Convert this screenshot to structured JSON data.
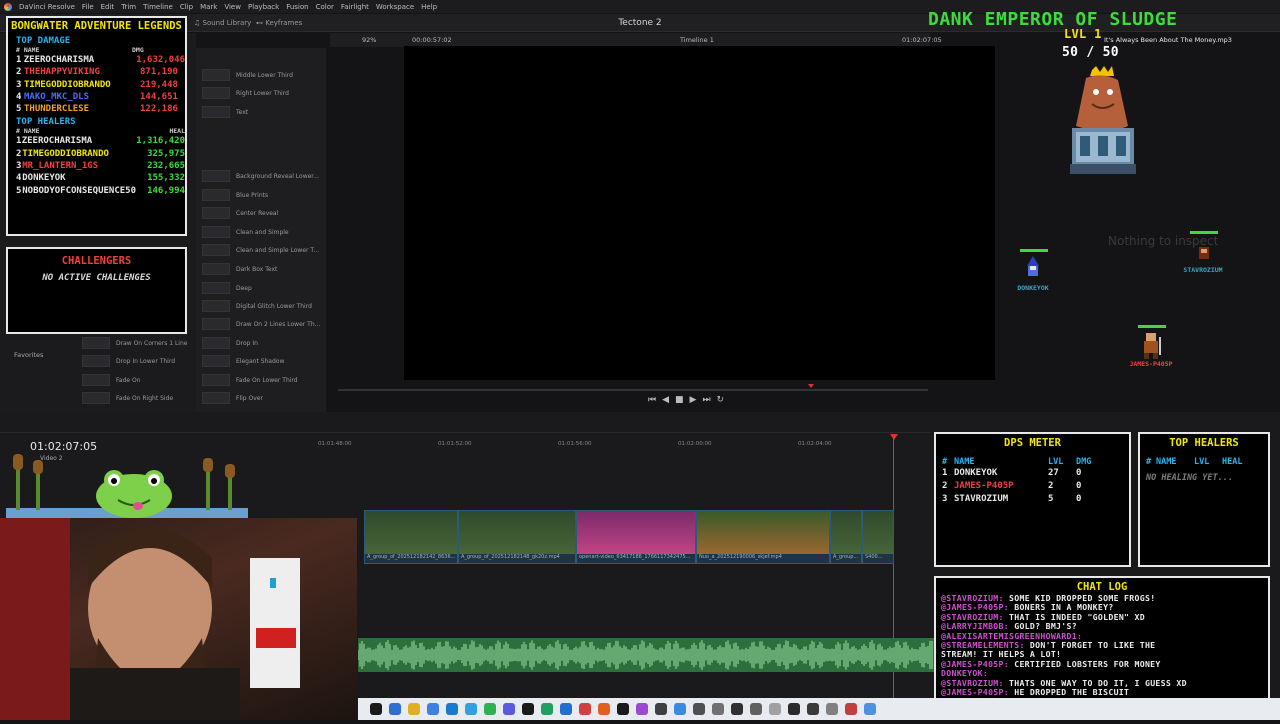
{
  "menu": {
    "items": [
      "DaVinci Resolve",
      "File",
      "Edit",
      "Trim",
      "Timeline",
      "Clip",
      "Mark",
      "View",
      "Playback",
      "Fusion",
      "Color",
      "Fairlight",
      "Workspace",
      "Help"
    ]
  },
  "toolbar": {
    "sound_library": "Sound Library",
    "keyframes": "Keyframes",
    "project_name": "Tectone 2"
  },
  "viewer_bar": {
    "zoom": "92%",
    "source_timecode": "00:00:57:02",
    "timeline_name": "Timeline 1",
    "record_timecode": "01:02:07:05"
  },
  "effects_left": [
    "Middle Lower Third",
    "Right Lower Third",
    "Text",
    "Background Reveal Lower...",
    "Blue Prints",
    "Center Reveal",
    "Clean and Simple",
    "Clean and Simple Lower T...",
    "Dark Box Text",
    "Deep",
    "Digital Glitch Lower Third",
    "Draw On 2 Lines Lower Th...",
    "Drop In",
    "Elegant Shadow",
    "Fade On Lower Third",
    "Flip Over"
  ],
  "effects_mid": [
    "Draw On Corners 1 Line",
    "Drop In Lower Third",
    "Fade On",
    "Fade On Right Side"
  ],
  "favorites_label": "Favorites",
  "leaderboard": {
    "title": "BONGWATER ADVENTURE LEGENDS",
    "damage_section": "TOP DAMAGE",
    "col_name": "# NAME",
    "col_dmg": "DMG",
    "damage_rows": [
      {
        "rank": "1",
        "name": "ZEEROCHARISMA",
        "value": "1,632,046",
        "color": "#e8e8e8"
      },
      {
        "rank": "2",
        "name": "THEHAPPYVIKING",
        "value": "871,190",
        "color": "#f04040"
      },
      {
        "rank": "3",
        "name": "TIMEGODDIOBRANDO",
        "value": "219,448",
        "color": "#f3e600"
      },
      {
        "rank": "4",
        "name": "MAKO_MKC_DLS",
        "value": "144,651",
        "color": "#4a6cf0"
      },
      {
        "rank": "5",
        "name": "THUNDERCLESE",
        "value": "122,186",
        "color": "#f0a030"
      }
    ],
    "healers_section": "TOP HEALERS",
    "col_heal": "HEAL",
    "heal_rows": [
      {
        "rank": "1",
        "name": "ZEEROCHARISMA",
        "value": "1,316,420",
        "color": "#e8e8e8"
      },
      {
        "rank": "2",
        "name": "TIMEGODDIOBRANDO",
        "value": "325,975",
        "color": "#f3e600"
      },
      {
        "rank": "3",
        "name": "MR_LANTERN_1GS",
        "value": "232,665",
        "color": "#f04040"
      },
      {
        "rank": "4",
        "name": "DONKEYOK",
        "value": "155,332",
        "color": "#e8e8e8"
      },
      {
        "rank": "5",
        "name": "NOBODYOFCONSEQUENCE50",
        "value": "146,994",
        "color": "#e8e8e8"
      }
    ]
  },
  "challengers": {
    "title": "CHALLENGERS",
    "empty": "NO ACTIVE CHALLENGES"
  },
  "game": {
    "title": "DANK EMPEROR OF SLUDGE",
    "level": "LVL 1",
    "hp_text": "50 / 50",
    "now_playing": "It's Always Been About The Money.mp3",
    "inspector_text": "Nothing to inspect",
    "players": [
      "DONKEYOK",
      "STAVROZIUM",
      "JAMES-P405P"
    ]
  },
  "dps_meter": {
    "title": "DPS METER",
    "col_num": "#",
    "col_name": "NAME",
    "col_lvl": "LVL",
    "col_dmg": "DMG",
    "rows": [
      {
        "rank": "1",
        "name": "DONKEYOK",
        "lvl": "27",
        "dmg": "0",
        "color": "#e8e8e8"
      },
      {
        "rank": "2",
        "name": "JAMES-P405P",
        "lvl": "2",
        "dmg": "0",
        "color": "#f04040"
      },
      {
        "rank": "3",
        "name": "STAVROZIUM",
        "lvl": "5",
        "dmg": "0",
        "color": "#e8e8e8"
      }
    ]
  },
  "top_healers_panel": {
    "title": "TOP HEALERS",
    "col_num": "#",
    "col_name": "NAME",
    "col_lvl": "LVL",
    "col_heal": "HEAL",
    "empty": "NO HEALING YET..."
  },
  "chat": {
    "title": "CHAT LOG",
    "lines": [
      {
        "user": "@STAVROZIUM:",
        "msg": "SOME KID DROPPED SOME FROGS!"
      },
      {
        "user": "@JAMES-P405P:",
        "msg": "BONERS IN A MONKEY?"
      },
      {
        "user": "@STAVROZIUM:",
        "msg": "THAT IS INDEED \"GOLDEN\" XD"
      },
      {
        "user": "@LARRYJIMBOB:",
        "msg": "GOLD? BMJ'S?"
      },
      {
        "user": "@ALEXISARTEMISGREENHOWARD1:",
        "msg": ""
      },
      {
        "user": "@STREAMELEMENTS:",
        "msg": "DON'T FORGET TO LIKE THE"
      },
      {
        "user": "",
        "msg": "STREAM! IT HELPS A LOT!"
      },
      {
        "user": "@JAMES-P405P:",
        "msg": "CERTIFIED LOBSTERS FOR MONEY"
      },
      {
        "user": "DONKEYOK:",
        "msg": ""
      },
      {
        "user": "@STAVROZIUM:",
        "msg": "THATS ONE WAY TO DO IT, I GUESS XD"
      },
      {
        "user": "@JAMES-P405P:",
        "msg": "HE DROPPED THE BISCUIT"
      }
    ]
  },
  "timeline": {
    "timecode": "01:02:07:05",
    "track_label": "Video 2",
    "ruler": [
      "01:01:48:00",
      "01:01:52:00",
      "01:01:56:00",
      "01:02:00:00",
      "01:02:04:00"
    ],
    "clips": [
      {
        "label": "A_group_of_202512182142_8636..."
      },
      {
        "label": "A_group_of_202512182148_gk20z.mp4"
      },
      {
        "label": "openart-video_63417186_1766117342475..."
      },
      {
        "label": "Nuo_a_202512190006_skjef.mp4"
      },
      {
        "label": "A_group..."
      },
      {
        "label": "S400..."
      }
    ]
  },
  "colors": {
    "accent_yellow": "#f3e600",
    "accent_blue": "#29b3f0",
    "accent_red": "#f04040",
    "accent_green": "#3ddc3d",
    "chat_user": "#d04fd0"
  }
}
